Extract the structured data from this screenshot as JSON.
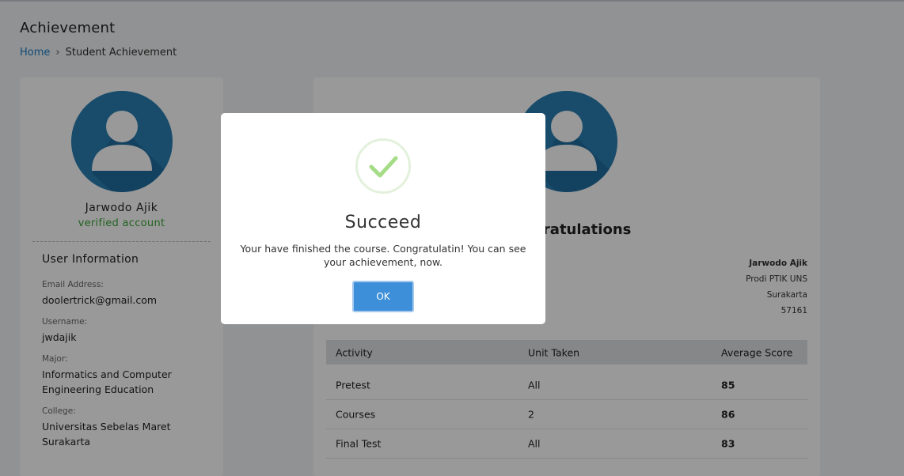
{
  "header": {
    "title": "Achievement",
    "breadcrumb": {
      "home": "Home",
      "separator": "›",
      "current": "Student Achievement"
    }
  },
  "profile": {
    "name": "Jarwodo Ajik",
    "status": "verified account",
    "info_title": "User Information",
    "fields": [
      {
        "label": "Email Address:",
        "value": "doolertrick@gmail.com"
      },
      {
        "label": "Username:",
        "value": "jwdajik"
      },
      {
        "label": "Major:",
        "value": "Informatics and Computer Engineering Education"
      },
      {
        "label": "College:",
        "value": "Universitas Sebelas Maret Surakarta"
      }
    ]
  },
  "certificate": {
    "title": "Congratulations",
    "address": {
      "name": "Jarwodo Ajik",
      "line2": "Prodi PTIK UNS",
      "line3": "Surakarta",
      "line4": "57161"
    },
    "table": {
      "headers": [
        "Activity",
        "Unit Taken",
        "Average Score"
      ],
      "rows": [
        {
          "activity": "Pretest",
          "unit": "All",
          "score": "85"
        },
        {
          "activity": "Courses",
          "unit": "2",
          "score": "86"
        },
        {
          "activity": "Final Test",
          "unit": "All",
          "score": "83"
        }
      ]
    }
  },
  "modal": {
    "icon": "checkmark-icon",
    "title": "Succeed",
    "message": "Your have finished the course. Congratulatin! You can see your achievement, now.",
    "ok_label": "OK"
  },
  "colors": {
    "link": "#1a7ec9",
    "verified": "#3aa53a",
    "avatar": "#2a7fb3",
    "ok_button": "#3d8fd9",
    "checkmark": "#a5dc86",
    "overlay": "rgba(0,0,0,0.4)"
  }
}
